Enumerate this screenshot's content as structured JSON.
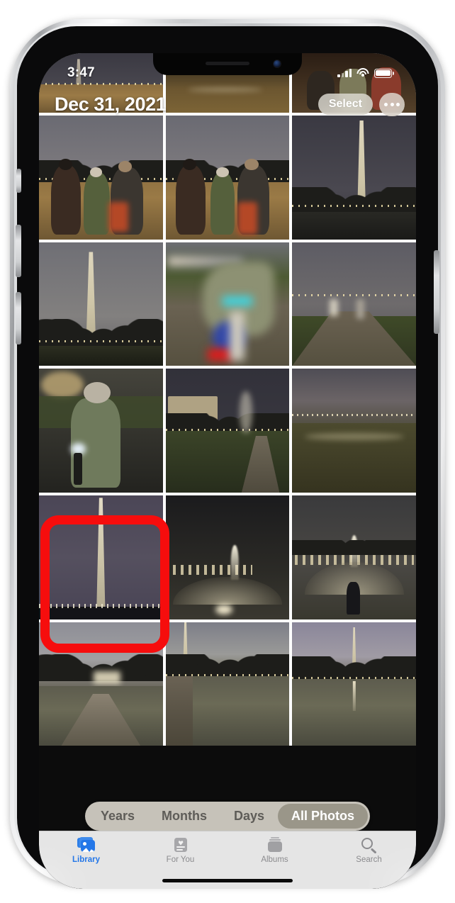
{
  "app": {
    "name": "Photos"
  },
  "status_bar": {
    "time": "3:47",
    "cellular_icon": "cellular-signal-icon",
    "wifi_icon": "wifi-icon",
    "battery_icon": "battery-icon"
  },
  "nav": {
    "title": "Dec 31, 2021",
    "select_label": "Select",
    "more_label": "•••"
  },
  "segmented_control": {
    "options": [
      {
        "label": "Years",
        "selected": false
      },
      {
        "label": "Months",
        "selected": false
      },
      {
        "label": "Days",
        "selected": false
      },
      {
        "label": "All Photos",
        "selected": true
      }
    ]
  },
  "tab_bar": {
    "tabs": [
      {
        "label": "Library",
        "icon": "photo-stack-icon",
        "selected": true
      },
      {
        "label": "For You",
        "icon": "heart-card-icon",
        "selected": false
      },
      {
        "label": "Albums",
        "icon": "albums-stack-icon",
        "selected": false
      },
      {
        "label": "Search",
        "icon": "search-icon",
        "selected": false
      }
    ],
    "active_color": "#2477e8",
    "inactive_color": "#8b8b8e"
  },
  "grid": {
    "columns": 3,
    "photos": [
      {
        "id": "p01",
        "alt": "Night street with Washington Monument, partial top row"
      },
      {
        "id": "p02",
        "alt": "Night roadway, partial top row"
      },
      {
        "id": "p03",
        "alt": "People walking at night, partial top row"
      },
      {
        "id": "p04",
        "alt": "Three people posing on the National Mall at night"
      },
      {
        "id": "p05",
        "alt": "Three people walking on the National Mall at night"
      },
      {
        "id": "p06",
        "alt": "Washington Monument lit at night with bare trees"
      },
      {
        "id": "p07",
        "alt": "Washington Monument lit at night, wide view"
      },
      {
        "id": "p08",
        "alt": "Blurry motion shot of a person walking at night"
      },
      {
        "id": "p09",
        "alt": "Curved walkway on the Mall at night with city lights"
      },
      {
        "id": "p10",
        "alt": "Woman in knit hat holding a light at night"
      },
      {
        "id": "p11",
        "alt": "Lit building across the Mall at night"
      },
      {
        "id": "p12",
        "alt": "Open grass field with distant city lights at dusk"
      },
      {
        "id": "p13",
        "alt": "Washington Monument against dark purple sky"
      },
      {
        "id": "p14",
        "alt": "World War II Memorial fountain at night"
      },
      {
        "id": "p15",
        "alt": "World War II Memorial fountain with person silhouette"
      },
      {
        "id": "p16",
        "alt": "Lincoln Memorial reflecting pool walkway at night"
      },
      {
        "id": "p17",
        "alt": "Reflecting pool with monument reflection and trees"
      },
      {
        "id": "p18",
        "alt": "Reflecting pool with Washington Monument mirrored"
      }
    ]
  },
  "annotation": {
    "type": "highlight-box",
    "color": "#f60d0d",
    "target_photo_id": "p13",
    "target_position": {
      "row": 4,
      "column": 1
    }
  },
  "device": {
    "side_buttons": [
      "mute-switch",
      "volume-up-button",
      "volume-down-button",
      "power-button"
    ],
    "home_indicator": true,
    "notch": true
  }
}
